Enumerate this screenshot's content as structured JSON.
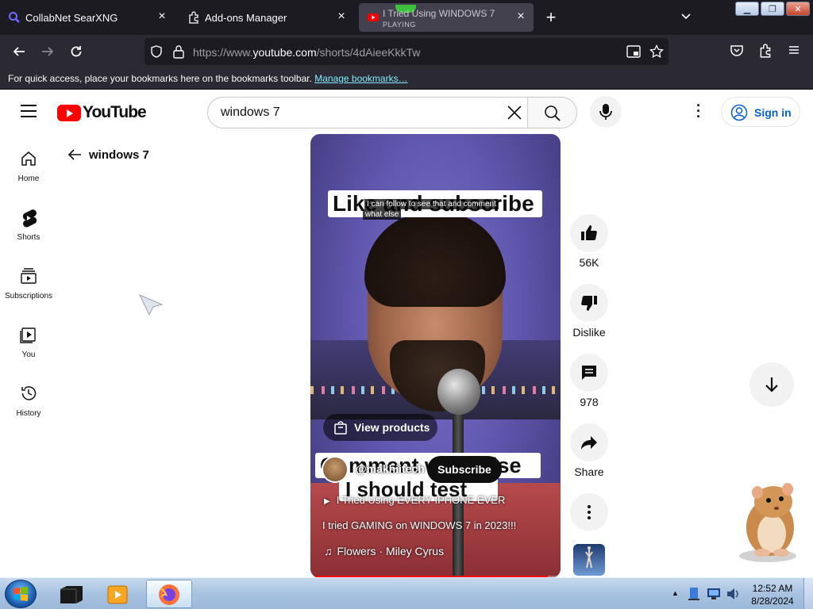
{
  "browser": {
    "tabs": [
      {
        "label": "CollabNet SearXNG",
        "icon": "search-icon"
      },
      {
        "label": "Add-ons Manager",
        "icon": "puzzle-icon"
      },
      {
        "label": "I Tried Using WINDOWS 7",
        "sublabel": "PLAYING",
        "icon": "youtube-icon"
      }
    ],
    "url_prefix": "https://www.",
    "url_domain": "youtube.com",
    "url_rest": "/shorts/4dAieeKkkTw",
    "bookmarks_text": "For quick access, place your bookmarks here on the bookmarks toolbar.",
    "bookmarks_link": "Manage bookmarks…"
  },
  "youtube": {
    "logo": "YouTube",
    "search_value": "windows 7",
    "signin": "Sign in",
    "back_label": "windows 7",
    "sidebar": [
      {
        "label": "Home",
        "icon": "home-icon"
      },
      {
        "label": "Shorts",
        "icon": "shorts-icon"
      },
      {
        "label": "Subscriptions",
        "icon": "subscriptions-icon"
      },
      {
        "label": "You",
        "icon": "you-icon"
      },
      {
        "label": "History",
        "icon": "history-icon"
      }
    ],
    "video": {
      "caption_top": "Like and subscribe",
      "sub_line_1": "I can follow to see that and comment",
      "sub_line_2": "what else",
      "view_products": "View products",
      "caption_mid": "Comment what else",
      "caption_low": "I should test",
      "channel": "@makhiitech",
      "subscribe": "Subscribe",
      "playlist": "I Tried Using EVERY IPHONE EVER",
      "title": "I tried GAMING on WINDOWS 7 in 2023!!!",
      "music": "Flowers · Miley Cyrus"
    },
    "actions": {
      "likes": "56K",
      "dislike": "Dislike",
      "comments": "978",
      "share": "Share"
    }
  },
  "taskbar": {
    "time": "12:52 AM",
    "date": "8/28/2024"
  }
}
